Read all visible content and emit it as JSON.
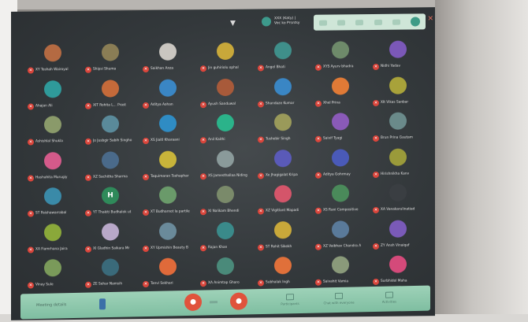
{
  "meeting": {
    "presenter_label": "XXX (Katy) | Voc ko Prsntsy",
    "meeting_code": "Meeting details"
  },
  "top_panel": {
    "icons": [
      "mic-icon",
      "camera-icon",
      "hand-icon",
      "captions-icon",
      "more-icon",
      "leave-icon"
    ]
  },
  "participants": [
    {
      "name": "XY Toshah Wairoyal",
      "initial": "",
      "color": "#b46a42"
    },
    {
      "name": "Shipsi Shuma",
      "initial": "",
      "color": "#8a7d55"
    },
    {
      "name": "Saikhan Anza",
      "initial": "",
      "color": "#c9c6c0"
    },
    {
      "name": "Jin guhiriolu ophal",
      "initial": "",
      "color": "#c8a83a"
    },
    {
      "name": "Angel Bhati",
      "initial": "",
      "color": "#3f8f8a"
    },
    {
      "name": "XYS Ayurv bhadra",
      "initial": "",
      "color": "#6e8a6a"
    },
    {
      "name": "Nidhi Yadav",
      "initial": "",
      "color": "#7b58b8"
    },
    {
      "name": "Ahajan Ali",
      "initial": "",
      "color": "#2f9a9a"
    },
    {
      "name": "XIT Rohita L... Prast",
      "initial": "",
      "color": "#c46a3a"
    },
    {
      "name": "Aditya Aohan",
      "initial": "",
      "color": "#3a86c4"
    },
    {
      "name": "Ayush Sanduwal",
      "initial": "",
      "color": "#a85a3a"
    },
    {
      "name": "Shandaze Kumar",
      "initial": "",
      "color": "#3a86c4"
    },
    {
      "name": "Xhel Prina",
      "initial": "",
      "color": "#e07a36"
    },
    {
      "name": "XIt Vikas Sanbar",
      "initial": "",
      "color": "#a8a23a"
    },
    {
      "name": "Ashishlal Shukla",
      "initial": "",
      "color": "#8a9a6a"
    },
    {
      "name": "Jo Jusbgir Sabih Singho",
      "initial": "",
      "color": "#5a8a9a"
    },
    {
      "name": "XS Jiaitl Kharaani",
      "initial": "",
      "color": "#2f8cc4"
    },
    {
      "name": "Anil Kaithi",
      "initial": "",
      "color": "#2bb38a"
    },
    {
      "name": "Tushebir Singh",
      "initial": "",
      "color": "#9a9a5a"
    },
    {
      "name": "Saivif Tyagi",
      "initial": "",
      "color": "#8a5ab8"
    },
    {
      "name": "Brun Prina Gautam",
      "initial": "",
      "color": "#6a8a8a"
    },
    {
      "name": "Hashahita Murugiy",
      "initial": "",
      "color": "#d45a8a"
    },
    {
      "name": "XZ Sachitha Sharma",
      "initial": "",
      "color": "#4a6a8a"
    },
    {
      "name": "Taquimaran Tsohaphar",
      "initial": "",
      "color": "#c8b43a"
    },
    {
      "name": "XS Jamesthallaa Niding",
      "initial": "",
      "color": "#8a9a9a"
    },
    {
      "name": "Xe Jhagigalat Kripa",
      "initial": "",
      "color": "#5a5ab8"
    },
    {
      "name": "Aditya Gohrmay",
      "initial": "",
      "color": "#4a5ab8"
    },
    {
      "name": "Hirishnikha Kanv",
      "initial": "",
      "color": "#9a9a3a"
    },
    {
      "name": "ST Paishawarrabal",
      "initial": "",
      "color": "#3a8aa8"
    },
    {
      "name": "YT Thakiti Budhalok ut",
      "initial": "H",
      "color": "#2f8a5a"
    },
    {
      "name": "XT Budharnot la partile",
      "initial": "",
      "color": "#6a9a6a"
    },
    {
      "name": "XI Nalikam Bhendi",
      "initial": "",
      "color": "#7a8a6a"
    },
    {
      "name": "XZ Vigitlant Mapadi",
      "initial": "",
      "color": "#d4556a"
    },
    {
      "name": "XS Rani Compositive",
      "initial": "",
      "color": "#4a8a5a"
    },
    {
      "name": "XA Vanakarulinatiad",
      "initial": "",
      "color": "#3a3e42"
    },
    {
      "name": "XA Fiamrhana Jaira",
      "initial": "",
      "color": "#8aa83a"
    },
    {
      "name": "XI Gladhin Saikara Mr",
      "initial": "",
      "color": "#b8a8c8"
    },
    {
      "name": "XY Upmishin Beauty B",
      "initial": "",
      "color": "#6a8a9a"
    },
    {
      "name": "Rajan Khan",
      "initial": "",
      "color": "#3a8a8a"
    },
    {
      "name": "ST Rohit Sikekh",
      "initial": "",
      "color": "#c8a83a"
    },
    {
      "name": "XZ Vaibhav Chandra A",
      "initial": "",
      "color": "#5a7a9a"
    },
    {
      "name": "ZY Ansh Vinaiqaf",
      "initial": "",
      "color": "#7a5ab8"
    },
    {
      "name": "Vinay Sule",
      "initial": "",
      "color": "#7a9a5a"
    },
    {
      "name": "ZE Sehar Namsih",
      "initial": "",
      "color": "#3a6a7a"
    },
    {
      "name": "Tanvi Sekhari",
      "initial": "",
      "color": "#e06a3a"
    },
    {
      "name": "XA Animtap Gharo",
      "initial": "",
      "color": "#4a8a7a"
    },
    {
      "name": "Subhalak Ingh",
      "initial": "",
      "color": "#e0703a"
    },
    {
      "name": "Saivahit Vamia",
      "initial": "",
      "color": "#8a9a7a"
    },
    {
      "name": "Surbhidol Maha",
      "initial": "",
      "color": "#d44a7a"
    }
  ],
  "bottom_bar": {
    "meeting_label": "Meeting details",
    "controls": [
      {
        "icon": "people-icon",
        "label": "Participants"
      },
      {
        "icon": "chat-icon",
        "label": "Chat with everyone"
      },
      {
        "icon": "activities-icon",
        "label": "Activities"
      }
    ]
  }
}
